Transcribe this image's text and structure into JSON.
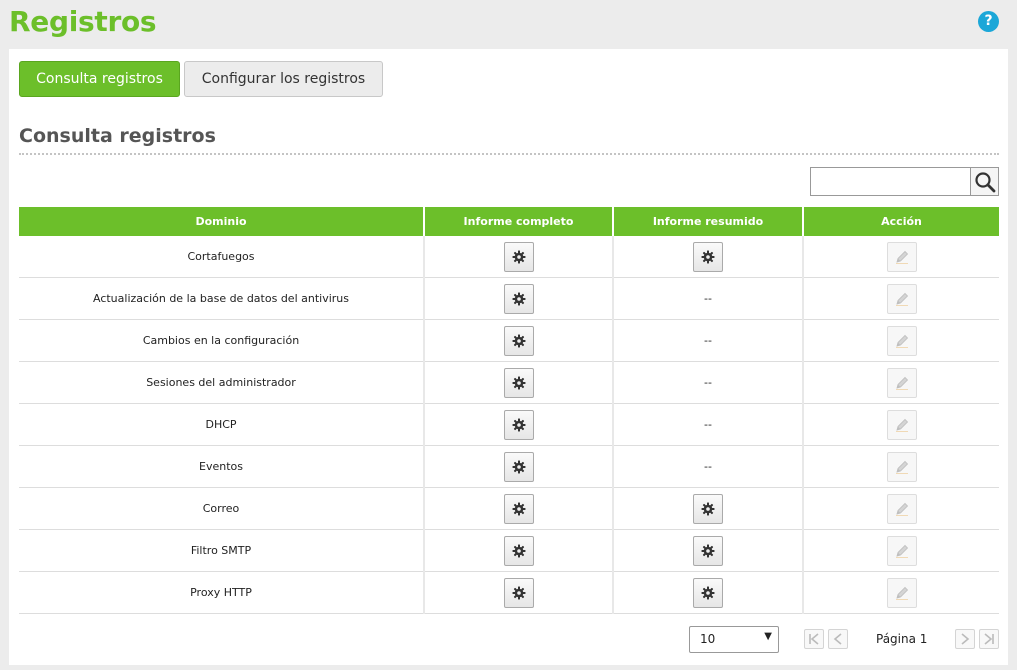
{
  "header": {
    "title": "Registros",
    "help_icon_glyph": "?"
  },
  "tabs": [
    {
      "label": "Consulta registros",
      "active": true
    },
    {
      "label": "Configurar los registros",
      "active": false
    }
  ],
  "section": {
    "title": "Consulta registros"
  },
  "search": {
    "value": "",
    "placeholder": ""
  },
  "table": {
    "columns": [
      "Dominio",
      "Informe completo",
      "Informe resumido",
      "Acción"
    ],
    "rows": [
      {
        "domain": "Cortafuegos",
        "full_report": true,
        "summary_report": true,
        "summary_text": ""
      },
      {
        "domain": "Actualización de la base de datos del antivirus",
        "full_report": true,
        "summary_report": false,
        "summary_text": "--"
      },
      {
        "domain": "Cambios en la configuración",
        "full_report": true,
        "summary_report": false,
        "summary_text": "--"
      },
      {
        "domain": "Sesiones del administrador",
        "full_report": true,
        "summary_report": false,
        "summary_text": "--"
      },
      {
        "domain": "DHCP",
        "full_report": true,
        "summary_report": false,
        "summary_text": "--"
      },
      {
        "domain": "Eventos",
        "full_report": true,
        "summary_report": false,
        "summary_text": "--"
      },
      {
        "domain": "Correo",
        "full_report": true,
        "summary_report": true,
        "summary_text": ""
      },
      {
        "domain": "Filtro SMTP",
        "full_report": true,
        "summary_report": true,
        "summary_text": ""
      },
      {
        "domain": "Proxy HTTP",
        "full_report": true,
        "summary_report": true,
        "summary_text": ""
      }
    ]
  },
  "pager": {
    "page_size": "10",
    "page_label": "Página 1"
  },
  "icons": {
    "help": "help-icon",
    "search": "search-icon",
    "gear": "gear-icon",
    "edit": "pencil-icon",
    "first": "first-page-icon",
    "prev": "prev-page-icon",
    "next": "next-page-icon",
    "last": "last-page-icon"
  },
  "colors": {
    "accent": "#6cbf2a",
    "help": "#1ba7d8"
  }
}
